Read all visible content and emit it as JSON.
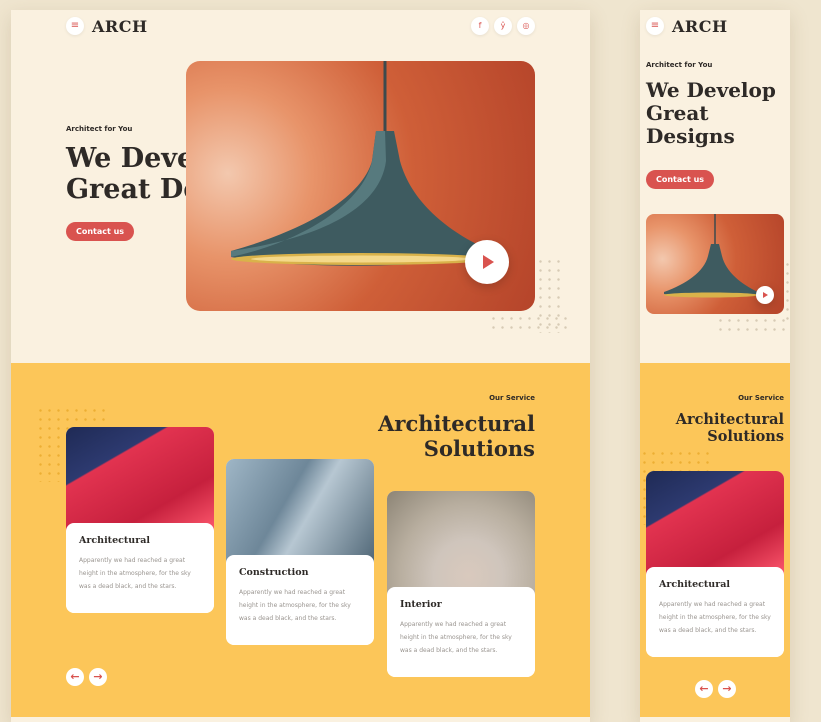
{
  "brand": {
    "menu_icon": "menu-icon",
    "logo": "ARCH"
  },
  "social": [
    {
      "name": "facebook-icon",
      "glyph": "f"
    },
    {
      "name": "twitter-icon",
      "glyph": "ŷ"
    },
    {
      "name": "instagram-icon",
      "glyph": "◎"
    }
  ],
  "hero": {
    "kicker": "Architect for You",
    "headline_line1": "We Develop",
    "headline_line2": "Great Designs",
    "mobile_line1": "We Develop",
    "mobile_line2": "Great",
    "mobile_line3": "Designs",
    "cta": "Contact us",
    "media": "pendant-lamp-photo",
    "play_icon": "play-icon"
  },
  "services": {
    "kicker": "Our Service",
    "title_line1": "Architectural",
    "title_line2": "Solutions",
    "cards": [
      {
        "title": "Architectural",
        "text": "Apparently we had reached a great height in the atmosphere, for the sky was a dead black, and the stars."
      },
      {
        "title": "Construction",
        "text": "Apparently we had reached a great height in the atmosphere, for the sky was a dead black, and the stars."
      },
      {
        "title": "Interior",
        "text": "Apparently we had reached a great height in the atmosphere, for the sky was a dead black, and the stars."
      }
    ],
    "prev_glyph": "←",
    "next_glyph": "→"
  },
  "colors": {
    "accent": "#d9534f",
    "cream": "#faf1e0",
    "yellow": "#fcc659",
    "ink": "#2e2a27"
  }
}
